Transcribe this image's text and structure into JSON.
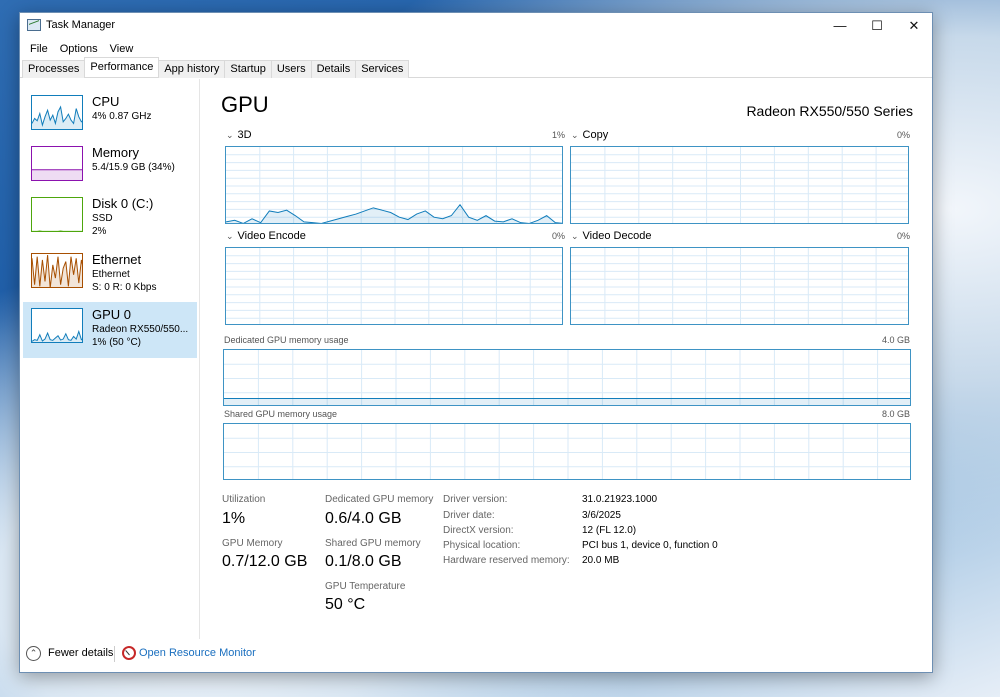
{
  "window": {
    "title": "Task Manager",
    "controls": {
      "minimize": "—",
      "maximize": "☐",
      "close": "✕"
    }
  },
  "menu": [
    "File",
    "Options",
    "View"
  ],
  "tabs": [
    "Processes",
    "Performance",
    "App history",
    "Startup",
    "Users",
    "Details",
    "Services"
  ],
  "active_tab": "Performance",
  "sidebar": [
    {
      "title": "CPU",
      "sub1": "4% 0.87 GHz",
      "sub2": "",
      "color": "#117dbb",
      "trace": [
        20,
        35,
        28,
        50,
        15,
        40,
        60,
        30,
        45,
        20,
        55,
        70,
        25,
        35,
        48,
        30,
        20,
        65,
        40,
        25,
        30
      ]
    },
    {
      "title": "Memory",
      "sub1": "5.4/15.9 GB (34%)",
      "sub2": "",
      "color": "#8b12ae",
      "trace": [
        34,
        34,
        34,
        34,
        34,
        34,
        34,
        34,
        34,
        34,
        34,
        34,
        34,
        34,
        34,
        34,
        34,
        34,
        34,
        34,
        34
      ]
    },
    {
      "title": "Disk 0 (C:)",
      "sub1": "SSD",
      "sub2": "2%",
      "color": "#4da60c",
      "trace": [
        2,
        2,
        2,
        3,
        2,
        2,
        2,
        2,
        2,
        2,
        2,
        3,
        2,
        2,
        2,
        2,
        2,
        2,
        2,
        2,
        2
      ]
    },
    {
      "title": "Ethernet",
      "sub1": "Ethernet",
      "sub2": "S: 0 R: 0 Kbps",
      "color": "#a74f01",
      "trace": [
        90,
        10,
        95,
        5,
        85,
        20,
        100,
        0,
        70,
        30,
        95,
        10,
        60,
        80,
        5,
        95,
        40,
        90,
        15,
        85,
        50
      ]
    },
    {
      "title": "GPU 0",
      "sub1": "Radeon RX550/550...",
      "sub2": "1% (50 °C)",
      "color": "#117dbb",
      "trace": [
        5,
        10,
        8,
        25,
        6,
        12,
        30,
        10,
        8,
        15,
        22,
        9,
        12,
        28,
        10,
        8,
        20,
        12,
        35,
        10,
        15
      ]
    }
  ],
  "selected_sidebar": 4,
  "header": {
    "title": "GPU",
    "model": "Radeon RX550/550 Series"
  },
  "engines": [
    {
      "name": "3D",
      "percent": "1%",
      "values": [
        4,
        6,
        2,
        8,
        3,
        18,
        16,
        19,
        12,
        4,
        3,
        2,
        5,
        8,
        11,
        14,
        18,
        22,
        19,
        16,
        10,
        7,
        14,
        18,
        10,
        8,
        12,
        26,
        10,
        6,
        12,
        5,
        4,
        8,
        3,
        2,
        6,
        12,
        3,
        2
      ]
    },
    {
      "name": "Copy",
      "percent": "0%",
      "values": []
    },
    {
      "name": "Video Encode",
      "percent": "0%",
      "values": []
    },
    {
      "name": "Video Decode",
      "percent": "0%",
      "values": []
    }
  ],
  "memory_graphs": [
    {
      "label": "Dedicated GPU memory usage",
      "max": "4.0 GB",
      "level": 0.15
    },
    {
      "label": "Shared GPU memory usage",
      "max": "8.0 GB",
      "level": 0.0125
    }
  ],
  "stats": {
    "utilization_label": "Utilization",
    "utilization": "1%",
    "gpu_memory_label": "GPU Memory",
    "gpu_memory": "0.7/12.0 GB",
    "dedicated_label": "Dedicated GPU memory",
    "dedicated": "0.6/4.0 GB",
    "shared_label": "Shared GPU memory",
    "shared": "0.1/8.0 GB",
    "temp_label": "GPU Temperature",
    "temp": "50 °C"
  },
  "info": [
    {
      "key": "Driver version:",
      "value": "31.0.21923.1000"
    },
    {
      "key": "Driver date:",
      "value": "3/6/2025"
    },
    {
      "key": "DirectX version:",
      "value": "12 (FL 12.0)"
    },
    {
      "key": "Physical location:",
      "value": "PCI bus 1, device 0, function 0"
    },
    {
      "key": "Hardware reserved memory:",
      "value": "20.0 MB"
    }
  ],
  "footer": {
    "fewer_details": "Fewer details",
    "resource_monitor": "Open Resource Monitor"
  }
}
